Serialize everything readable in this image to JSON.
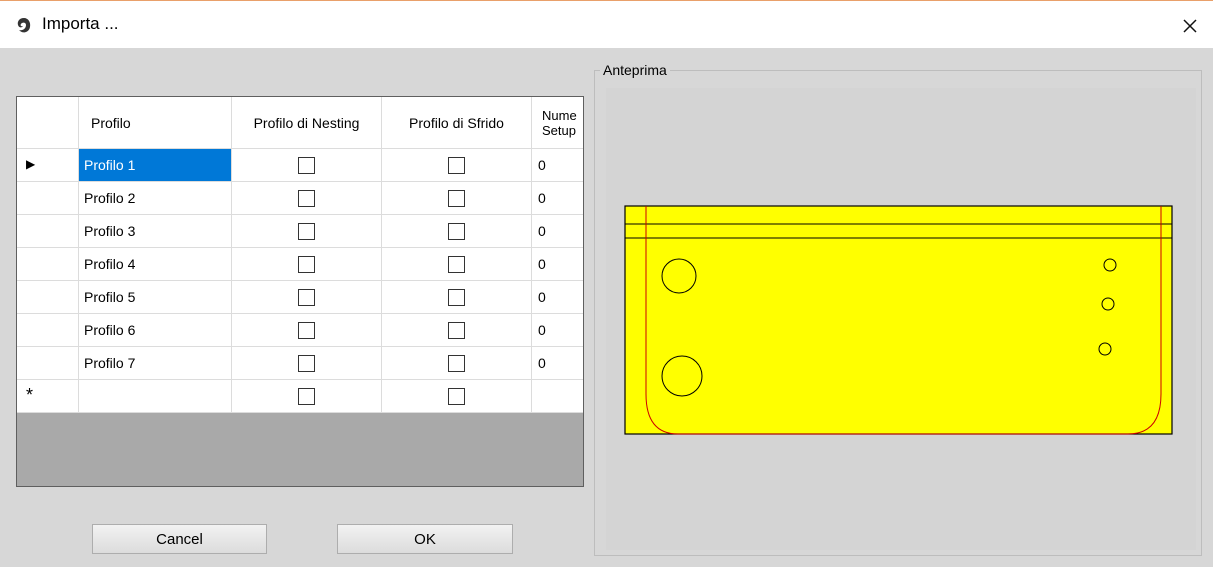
{
  "window": {
    "title": "Importa ...",
    "close_glyph": "✕",
    "icon": "app-icon"
  },
  "grid": {
    "row_header_current": "▶",
    "row_header_new": "*",
    "columns": [
      {
        "label": "Profilo"
      },
      {
        "label": "Profilo di Nesting"
      },
      {
        "label": "Profilo di Sfrido"
      },
      {
        "label": "Nume\nSetup"
      }
    ],
    "rows": [
      {
        "profilo": "Profilo 1",
        "nesting": false,
        "sfrido": false,
        "num": "0",
        "selected": true
      },
      {
        "profilo": "Profilo 2",
        "nesting": false,
        "sfrido": false,
        "num": "0"
      },
      {
        "profilo": "Profilo 3",
        "nesting": false,
        "sfrido": false,
        "num": "0"
      },
      {
        "profilo": "Profilo 4",
        "nesting": false,
        "sfrido": false,
        "num": "0"
      },
      {
        "profilo": "Profilo 5",
        "nesting": false,
        "sfrido": false,
        "num": "0"
      },
      {
        "profilo": "Profilo 6",
        "nesting": false,
        "sfrido": false,
        "num": "0"
      },
      {
        "profilo": "Profilo 7",
        "nesting": false,
        "sfrido": false,
        "num": "0"
      }
    ],
    "scroll_left_glyph": "<",
    "scroll_right_glyph": ">"
  },
  "buttons": {
    "cancel": "Cancel",
    "ok": "OK"
  },
  "preview": {
    "label": "Anteprima",
    "fill_color": "#ffff00",
    "outline_color": "#000000",
    "contour_color": "#cc0000"
  },
  "colors": {
    "selection": "#0078d7",
    "grid_background": "#a9a9a9"
  }
}
